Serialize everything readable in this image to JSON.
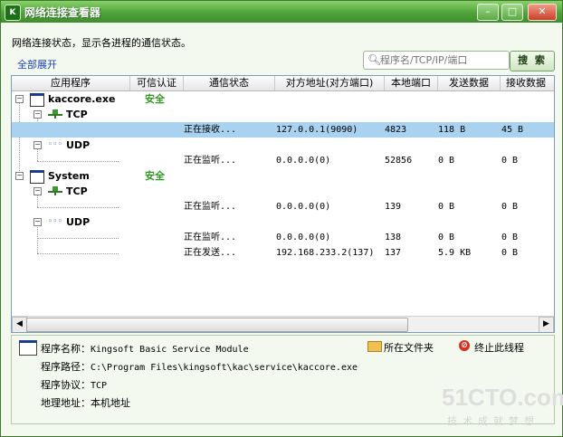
{
  "window": {
    "title": "网络连接查看器",
    "app_icon": "kingsoft-logo-icon",
    "controls": [
      "minimize-icon",
      "maximize-icon",
      "close-icon"
    ]
  },
  "header": {
    "description": "网络连接状态，显示各进程的通信状态。",
    "expand_all": "全部展开",
    "search_placeholder": "程序名/TCP/IP/端口",
    "search_button": "搜 索"
  },
  "table": {
    "columns": [
      "应用程序",
      "可信认证",
      "通信状态",
      "对方地址(对方端口)",
      "本地端口",
      "发送数据",
      "接收数据"
    ],
    "processes": [
      {
        "name": "kaccore.exe",
        "trust": "安全",
        "protocols": [
          {
            "name": "TCP",
            "connections": [
              {
                "state": "正在接收...",
                "remote": "127.0.0.1(9090)",
                "local_port": "4823",
                "sent": "118 B",
                "received": "45 B",
                "selected": true
              }
            ]
          },
          {
            "name": "UDP",
            "connections": [
              {
                "state": "正在监听...",
                "remote": "0.0.0.0(0)",
                "local_port": "52856",
                "sent": "0 B",
                "received": "0 B",
                "selected": false
              }
            ]
          }
        ]
      },
      {
        "name": "System",
        "trust": "安全",
        "protocols": [
          {
            "name": "TCP",
            "connections": [
              {
                "state": "正在监听...",
                "remote": "0.0.0.0(0)",
                "local_port": "139",
                "sent": "0 B",
                "received": "0 B",
                "selected": false
              }
            ]
          },
          {
            "name": "UDP",
            "connections": [
              {
                "state": "正在监听...",
                "remote": "0.0.0.0(0)",
                "local_port": "138",
                "sent": "0 B",
                "received": "0 B",
                "selected": false
              },
              {
                "state": "正在发送...",
                "remote": "192.168.233.2(137)",
                "local_port": "137",
                "sent": "5.9 KB",
                "received": "0 B",
                "selected": false
              }
            ]
          }
        ]
      }
    ]
  },
  "details": {
    "name_label": "程序名称：",
    "name_value": "Kingsoft Basic Service Module",
    "path_label": "程序路径：",
    "path_value": "C:\\Program Files\\kingsoft\\kac\\service\\kaccore.exe",
    "protocol_label": "程序协议：",
    "protocol_value": "TCP",
    "address_label": "地理地址：",
    "address_value": "本机地址",
    "open_folder": "所在文件夹",
    "terminate": "终止此线程"
  },
  "watermark": {
    "logo": "51CTO.com",
    "tagline": "技术成就梦想"
  }
}
